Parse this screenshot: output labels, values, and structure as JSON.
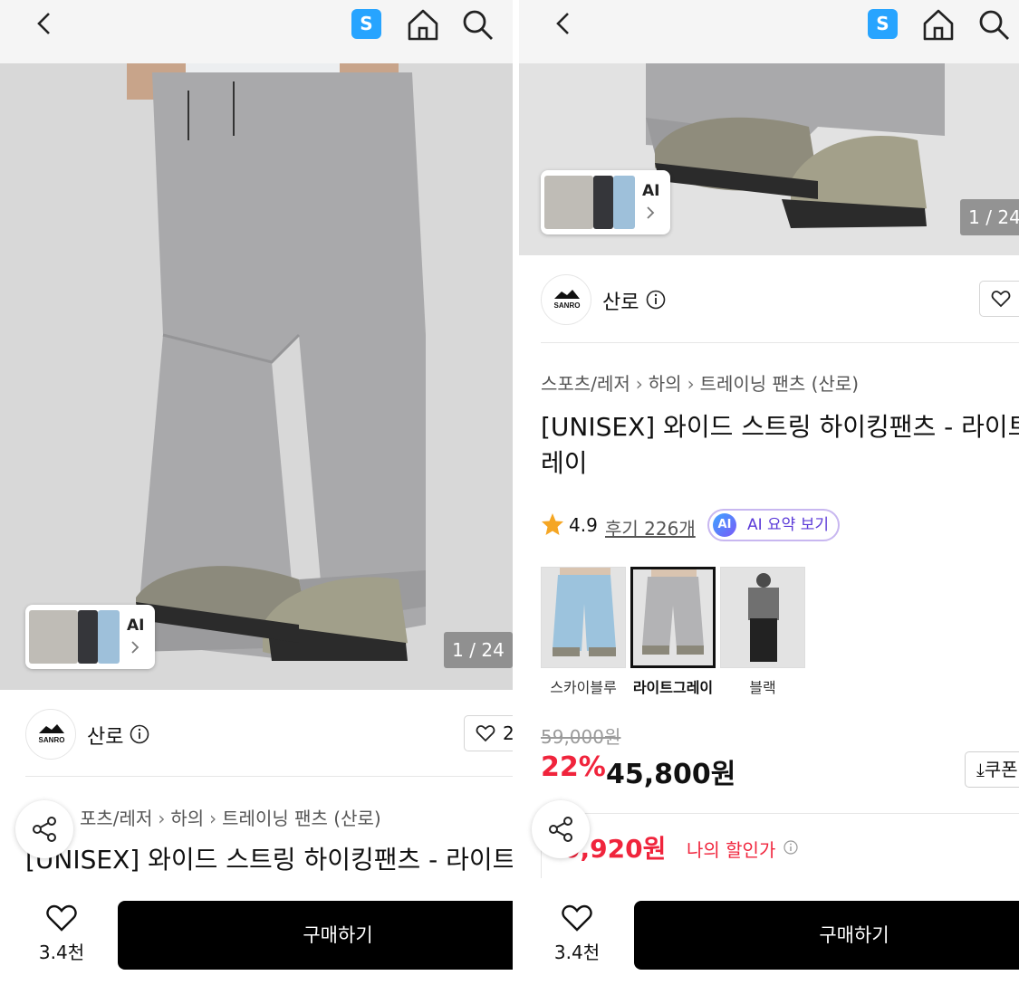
{
  "header": {
    "s_badge": "S",
    "icons": [
      "back-icon",
      "s-badge",
      "home-icon",
      "search-icon"
    ]
  },
  "product": {
    "image_counter": "1 / 24",
    "ai_badge": "AI",
    "brand": "산로",
    "logo_text": "SANRO",
    "wish_count": "2",
    "breadcrumb": [
      "스포츠/레저",
      "하의",
      "트레이닝 팬츠 (산로)"
    ],
    "breadcrumb_left_visible": [
      "포츠/레저",
      "하의",
      "트레이닝 팬츠 (산로)"
    ],
    "title_right": "[UNISEX] 와이드 스트링 하이킹팬츠 - 라이트그\n레이",
    "title_left": "[UNISEX] 와이드 스트링 하이킹팬츠 - 라이트그",
    "rating": "4.9",
    "reviews": "후기 226개",
    "ai_summary": "AI 요약 보기",
    "ai_dot": "AI",
    "colors": [
      {
        "label": "스카이블루",
        "selected": false
      },
      {
        "label": "라이트그레이",
        "selected": true
      },
      {
        "label": "블랙",
        "selected": false
      }
    ],
    "original_price": "59,000원",
    "discount": "22%",
    "price": "45,800원",
    "coupon": "쿠폰",
    "my_price": "40,920원",
    "my_price_visible": "0,920원",
    "my_price_label": "나의 할인가"
  },
  "bottom": {
    "like_count": "3.4천",
    "buy_label": "구매하기"
  },
  "colors": {
    "accent_red": "#f0243c",
    "s_badge": "#27a4ff",
    "buy_bg": "#000000"
  }
}
